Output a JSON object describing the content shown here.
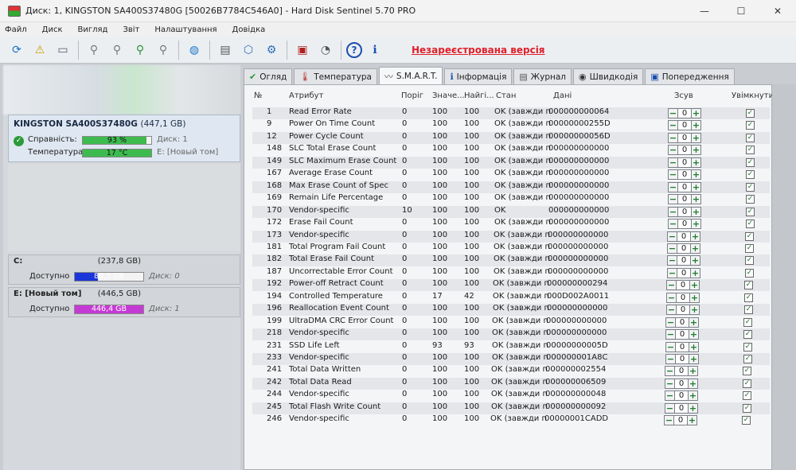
{
  "window": {
    "title": "Диск: 1, KINGSTON SA400S37480G [50026B7784C546A0]  -  Hard Disk Sentinel 5.70 PRO",
    "minimize": "—",
    "maximize": "☐",
    "close": "✕"
  },
  "menu": [
    "Файл",
    "Диск",
    "Вигляд",
    "Звіт",
    "Налаштування",
    "Довідка"
  ],
  "toolbar": {
    "unregistered": "Незареєстрована версія"
  },
  "disk": {
    "name": "KINGSTON SA400S37480G",
    "size": "(447,1 GB)",
    "health_label": "Справність:",
    "health_value": "93 %",
    "health_pct": 93,
    "health_disk": "Диск: 1",
    "temp_label": "Температура:",
    "temp_value": "17 °C",
    "temp_pct": 17,
    "temp_volume": "E: [Новый том]"
  },
  "volumes": [
    {
      "name": "C:",
      "size": "(237,8 GB)",
      "free_label": "Доступно",
      "free": "80,3 GB",
      "free_pct": 34,
      "disk": "Диск: 0",
      "color": "#1a35d8"
    },
    {
      "name": "E: [Новый том]",
      "size": "(446,5 GB)",
      "free_label": "Доступно",
      "free": "446,4 GB",
      "free_pct": 100,
      "disk": "Диск: 1",
      "color": "#c43ad4"
    }
  ],
  "tabs": [
    {
      "label": "Огляд",
      "icon": "✔"
    },
    {
      "label": "Температура",
      "icon": "🌡"
    },
    {
      "label": "S.M.A.R.T.",
      "icon": "〰"
    },
    {
      "label": "Інформація",
      "icon": "ℹ"
    },
    {
      "label": "Журнал",
      "icon": "▤"
    },
    {
      "label": "Швидкодія",
      "icon": "◉"
    },
    {
      "label": "Попередження",
      "icon": "▣"
    }
  ],
  "smart": {
    "headers": {
      "no": "№",
      "attr": "Атрибут",
      "threshold": "Поріг",
      "value": "Значе...",
      "worst": "Найгі...",
      "status": "Стан",
      "data": "Дані",
      "offset": "Зсув",
      "enabled": "Увімкнути"
    },
    "rows": [
      [
        "1",
        "Read Error Rate",
        "0",
        "100",
        "100",
        "OK (завжди п...",
        "000000000064"
      ],
      [
        "9",
        "Power On Time Count",
        "0",
        "100",
        "100",
        "OK (завжди п...",
        "00000000255D"
      ],
      [
        "12",
        "Power Cycle Count",
        "0",
        "100",
        "100",
        "OK (завжди п...",
        "00000000056D"
      ],
      [
        "148",
        "SLC Total Erase Count",
        "0",
        "100",
        "100",
        "OK (завжди п...",
        "000000000000"
      ],
      [
        "149",
        "SLC Maximum Erase Count",
        "0",
        "100",
        "100",
        "OK (завжди п...",
        "000000000000"
      ],
      [
        "167",
        "Average Erase Count",
        "0",
        "100",
        "100",
        "OK (завжди п...",
        "000000000000"
      ],
      [
        "168",
        "Max Erase Count of Spec",
        "0",
        "100",
        "100",
        "OK (завжди п...",
        "000000000000"
      ],
      [
        "169",
        "Remain Life Percentage",
        "0",
        "100",
        "100",
        "OK (завжди п...",
        "000000000000"
      ],
      [
        "170",
        "Vendor-specific",
        "10",
        "100",
        "100",
        "OK",
        "000000000000"
      ],
      [
        "172",
        "Erase Fail Count",
        "0",
        "100",
        "100",
        "OK (завжди п...",
        "000000000000"
      ],
      [
        "173",
        "Vendor-specific",
        "0",
        "100",
        "100",
        "OK (завжди п...",
        "000000000000"
      ],
      [
        "181",
        "Total Program Fail Count",
        "0",
        "100",
        "100",
        "OK (завжди п...",
        "000000000000"
      ],
      [
        "182",
        "Total Erase Fail Count",
        "0",
        "100",
        "100",
        "OK (завжди п...",
        "000000000000"
      ],
      [
        "187",
        "Uncorrectable Error Count",
        "0",
        "100",
        "100",
        "OK (завжди п...",
        "000000000000"
      ],
      [
        "192",
        "Power-off Retract Count",
        "0",
        "100",
        "100",
        "OK (завжди п...",
        "000000000294"
      ],
      [
        "194",
        "Controlled Temperature",
        "0",
        "17",
        "42",
        "OK (завжди п...",
        "000D002A0011"
      ],
      [
        "196",
        "Reallocation Event Count",
        "0",
        "100",
        "100",
        "OK (завжди п...",
        "000000000000"
      ],
      [
        "199",
        "UltraDMA CRC Error Count",
        "0",
        "100",
        "100",
        "OK (завжди п...",
        "000000000000"
      ],
      [
        "218",
        "Vendor-specific",
        "0",
        "100",
        "100",
        "OK (завжди п...",
        "000000000000"
      ],
      [
        "231",
        "SSD Life Left",
        "0",
        "93",
        "93",
        "OK (завжди п...",
        "00000000005D"
      ],
      [
        "233",
        "Vendor-specific",
        "0",
        "100",
        "100",
        "OK (завжди п...",
        "000000001A8C"
      ],
      [
        "241",
        "Total Data Written",
        "0",
        "100",
        "100",
        "OK (завжди п...",
        "000000002554"
      ],
      [
        "242",
        "Total Data Read",
        "0",
        "100",
        "100",
        "OK (завжди п...",
        "000000006509"
      ],
      [
        "244",
        "Vendor-specific",
        "0",
        "100",
        "100",
        "OK (завжди п...",
        "000000000048"
      ],
      [
        "245",
        "Total Flash Write Count",
        "0",
        "100",
        "100",
        "OK (завжди п...",
        "000000000092"
      ],
      [
        "246",
        "Vendor-specific",
        "0",
        "100",
        "100",
        "OK (завжди п...",
        "00000001CADD"
      ]
    ],
    "offset_value": "0",
    "minus": "−",
    "plus": "+",
    "check": "✓"
  }
}
